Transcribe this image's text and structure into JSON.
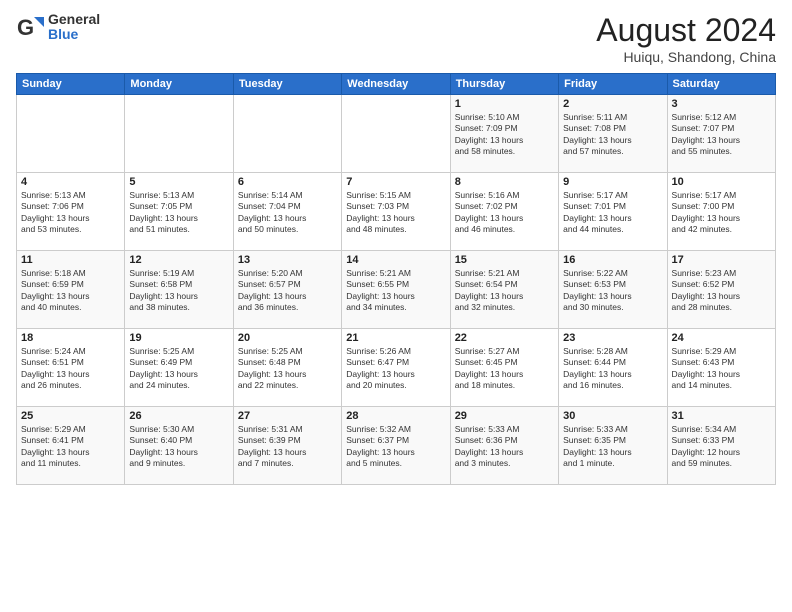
{
  "header": {
    "logo_general": "General",
    "logo_blue": "Blue",
    "title": "August 2024",
    "location": "Huiqu, Shandong, China"
  },
  "days_of_week": [
    "Sunday",
    "Monday",
    "Tuesday",
    "Wednesday",
    "Thursday",
    "Friday",
    "Saturday"
  ],
  "weeks": [
    [
      {
        "day": "",
        "info": ""
      },
      {
        "day": "",
        "info": ""
      },
      {
        "day": "",
        "info": ""
      },
      {
        "day": "",
        "info": ""
      },
      {
        "day": "1",
        "info": "Sunrise: 5:10 AM\nSunset: 7:09 PM\nDaylight: 13 hours\nand 58 minutes."
      },
      {
        "day": "2",
        "info": "Sunrise: 5:11 AM\nSunset: 7:08 PM\nDaylight: 13 hours\nand 57 minutes."
      },
      {
        "day": "3",
        "info": "Sunrise: 5:12 AM\nSunset: 7:07 PM\nDaylight: 13 hours\nand 55 minutes."
      }
    ],
    [
      {
        "day": "4",
        "info": "Sunrise: 5:13 AM\nSunset: 7:06 PM\nDaylight: 13 hours\nand 53 minutes."
      },
      {
        "day": "5",
        "info": "Sunrise: 5:13 AM\nSunset: 7:05 PM\nDaylight: 13 hours\nand 51 minutes."
      },
      {
        "day": "6",
        "info": "Sunrise: 5:14 AM\nSunset: 7:04 PM\nDaylight: 13 hours\nand 50 minutes."
      },
      {
        "day": "7",
        "info": "Sunrise: 5:15 AM\nSunset: 7:03 PM\nDaylight: 13 hours\nand 48 minutes."
      },
      {
        "day": "8",
        "info": "Sunrise: 5:16 AM\nSunset: 7:02 PM\nDaylight: 13 hours\nand 46 minutes."
      },
      {
        "day": "9",
        "info": "Sunrise: 5:17 AM\nSunset: 7:01 PM\nDaylight: 13 hours\nand 44 minutes."
      },
      {
        "day": "10",
        "info": "Sunrise: 5:17 AM\nSunset: 7:00 PM\nDaylight: 13 hours\nand 42 minutes."
      }
    ],
    [
      {
        "day": "11",
        "info": "Sunrise: 5:18 AM\nSunset: 6:59 PM\nDaylight: 13 hours\nand 40 minutes."
      },
      {
        "day": "12",
        "info": "Sunrise: 5:19 AM\nSunset: 6:58 PM\nDaylight: 13 hours\nand 38 minutes."
      },
      {
        "day": "13",
        "info": "Sunrise: 5:20 AM\nSunset: 6:57 PM\nDaylight: 13 hours\nand 36 minutes."
      },
      {
        "day": "14",
        "info": "Sunrise: 5:21 AM\nSunset: 6:55 PM\nDaylight: 13 hours\nand 34 minutes."
      },
      {
        "day": "15",
        "info": "Sunrise: 5:21 AM\nSunset: 6:54 PM\nDaylight: 13 hours\nand 32 minutes."
      },
      {
        "day": "16",
        "info": "Sunrise: 5:22 AM\nSunset: 6:53 PM\nDaylight: 13 hours\nand 30 minutes."
      },
      {
        "day": "17",
        "info": "Sunrise: 5:23 AM\nSunset: 6:52 PM\nDaylight: 13 hours\nand 28 minutes."
      }
    ],
    [
      {
        "day": "18",
        "info": "Sunrise: 5:24 AM\nSunset: 6:51 PM\nDaylight: 13 hours\nand 26 minutes."
      },
      {
        "day": "19",
        "info": "Sunrise: 5:25 AM\nSunset: 6:49 PM\nDaylight: 13 hours\nand 24 minutes."
      },
      {
        "day": "20",
        "info": "Sunrise: 5:25 AM\nSunset: 6:48 PM\nDaylight: 13 hours\nand 22 minutes."
      },
      {
        "day": "21",
        "info": "Sunrise: 5:26 AM\nSunset: 6:47 PM\nDaylight: 13 hours\nand 20 minutes."
      },
      {
        "day": "22",
        "info": "Sunrise: 5:27 AM\nSunset: 6:45 PM\nDaylight: 13 hours\nand 18 minutes."
      },
      {
        "day": "23",
        "info": "Sunrise: 5:28 AM\nSunset: 6:44 PM\nDaylight: 13 hours\nand 16 minutes."
      },
      {
        "day": "24",
        "info": "Sunrise: 5:29 AM\nSunset: 6:43 PM\nDaylight: 13 hours\nand 14 minutes."
      }
    ],
    [
      {
        "day": "25",
        "info": "Sunrise: 5:29 AM\nSunset: 6:41 PM\nDaylight: 13 hours\nand 11 minutes."
      },
      {
        "day": "26",
        "info": "Sunrise: 5:30 AM\nSunset: 6:40 PM\nDaylight: 13 hours\nand 9 minutes."
      },
      {
        "day": "27",
        "info": "Sunrise: 5:31 AM\nSunset: 6:39 PM\nDaylight: 13 hours\nand 7 minutes."
      },
      {
        "day": "28",
        "info": "Sunrise: 5:32 AM\nSunset: 6:37 PM\nDaylight: 13 hours\nand 5 minutes."
      },
      {
        "day": "29",
        "info": "Sunrise: 5:33 AM\nSunset: 6:36 PM\nDaylight: 13 hours\nand 3 minutes."
      },
      {
        "day": "30",
        "info": "Sunrise: 5:33 AM\nSunset: 6:35 PM\nDaylight: 13 hours\nand 1 minute."
      },
      {
        "day": "31",
        "info": "Sunrise: 5:34 AM\nSunset: 6:33 PM\nDaylight: 12 hours\nand 59 minutes."
      }
    ]
  ]
}
